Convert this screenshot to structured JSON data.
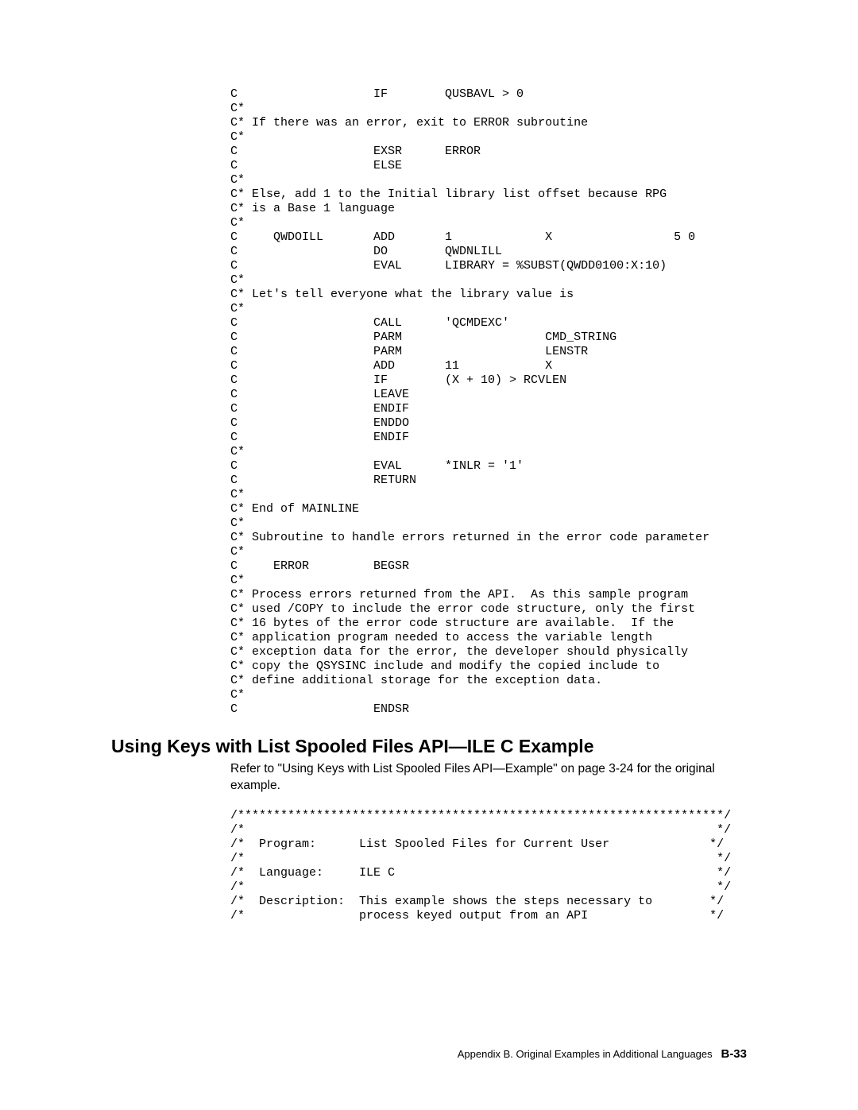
{
  "code_block_1": "C                   IF        QUSBAVL > 0\nC*\nC* If there was an error, exit to ERROR subroutine\nC*\nC                   EXSR      ERROR\nC                   ELSE\nC*\nC* Else, add 1 to the Initial library list offset because RPG\nC* is a Base 1 language\nC*\nC     QWDOILL       ADD       1             X                 5 0\nC                   DO        QWDNLILL\nC                   EVAL      LIBRARY = %SUBST(QWDD0100:X:10)\nC*\nC* Let's tell everyone what the library value is\nC*\nC                   CALL      'QCMDEXC'\nC                   PARM                    CMD_STRING\nC                   PARM                    LENSTR\nC                   ADD       11            X\nC                   IF        (X + 10) > RCVLEN\nC                   LEAVE\nC                   ENDIF\nC                   ENDDO\nC                   ENDIF\nC*\nC                   EVAL      *INLR = '1'\nC                   RETURN\nC*\nC* End of MAINLINE\nC*\nC* Subroutine to handle errors returned in the error code parameter\nC*\nC     ERROR         BEGSR\nC*\nC* Process errors returned from the API.  As this sample program\nC* used /COPY to include the error code structure, only the first\nC* 16 bytes of the error code structure are available.  If the\nC* application program needed to access the variable length\nC* exception data for the error, the developer should physically\nC* copy the QSYSINC include and modify the copied include to\nC* define additional storage for the exception data.\nC*\nC                   ENDSR",
  "section_heading": "Using Keys with List Spooled Files API—ILE C Example",
  "section_desc": "Refer to \"Using Keys with List Spooled Files API—Example\" on page 3-24 for the original example.",
  "code_block_2": "/********************************************************************/\n/*                                                                  */\n/*  Program:      List Spooled Files for Current User              */\n/*                                                                  */\n/*  Language:     ILE C                                             */\n/*                                                                  */\n/*  Description:  This example shows the steps necessary to        */\n/*                process keyed output from an API                 */",
  "footer_text": "Appendix B.  Original Examples in Additional Languages",
  "footer_page": "B-33"
}
